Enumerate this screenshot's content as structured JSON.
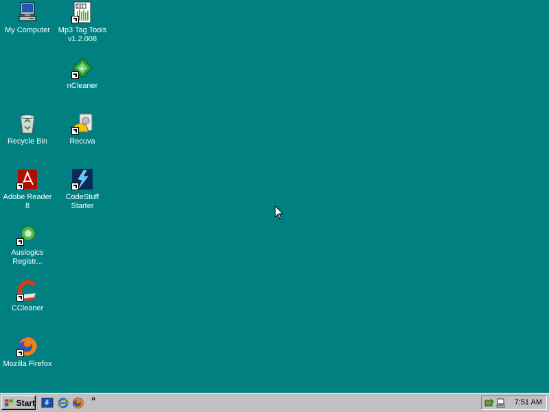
{
  "desktop": {
    "background_color": "#008080",
    "icons": [
      {
        "label": "My Computer",
        "icon": "computer-icon"
      },
      {
        "label": "Mp3 Tag Tools\nv1.2.008",
        "icon": "mp3-tag-tools-icon"
      },
      {
        "label": "nCleaner",
        "icon": "ncleaner-icon"
      },
      {
        "label": "Recycle Bin",
        "icon": "recycle-bin-icon"
      },
      {
        "label": "Recuva",
        "icon": "recuva-icon"
      },
      {
        "label": "Adobe Reader\n8",
        "icon": "adobe-reader-icon"
      },
      {
        "label": "CodeStuff\nStarter",
        "icon": "codestuff-starter-icon"
      },
      {
        "label": "Auslogics\nRegistr...",
        "icon": "auslogics-icon"
      },
      {
        "label": "CCleaner",
        "icon": "ccleaner-icon"
      },
      {
        "label": "Mozilla Firefox",
        "icon": "firefox-icon"
      }
    ]
  },
  "taskbar": {
    "start_label": "Start",
    "quick_launch": [
      {
        "icon": "show-desktop-icon"
      },
      {
        "icon": "internet-explorer-icon"
      },
      {
        "icon": "firefox-icon"
      }
    ],
    "more_label": "»",
    "tray": {
      "icons": [
        "safely-remove-hardware-icon",
        "network-icon"
      ],
      "clock": "7:51 AM"
    }
  }
}
